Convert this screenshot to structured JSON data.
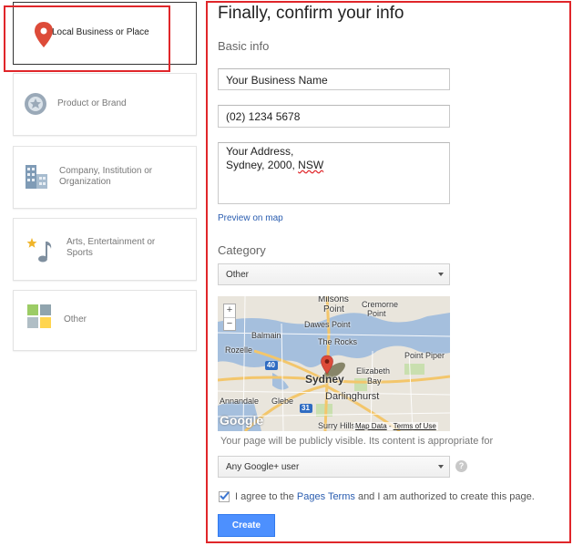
{
  "categories": [
    {
      "label_lines": [
        "Local Business or Place"
      ],
      "icon": "map-pin-icon"
    },
    {
      "label_lines": [
        "Product or Brand"
      ],
      "icon": "brand-tag-icon"
    },
    {
      "label_lines": [
        "Company, Institution or",
        "Organization"
      ],
      "icon": "building-icon"
    },
    {
      "label_lines": [
        "Arts, Entertainment or",
        "Sports"
      ],
      "icon": "music-star-icon"
    },
    {
      "label_lines": [
        "Other"
      ],
      "icon": "grid-tiles-icon"
    }
  ],
  "form": {
    "title": "Finally, confirm your info",
    "basic_info_label": "Basic info",
    "business_name": "Your Business Name",
    "phone": "(02) 1234 5678",
    "address_line1": "Your Address,",
    "address_line2_prefix": "Sydney, 2000, ",
    "address_line2_state": "NSW",
    "preview_link": "Preview on map",
    "category_label": "Category",
    "category_value": "Other",
    "visibility_text": "Your page will be publicly visible. Its content is appropriate for",
    "audience_value": "Any Google+ user",
    "help_glyph": "?",
    "agree_prefix": "I agree to the ",
    "agree_link": "Pages Terms",
    "agree_suffix": " and I am authorized to create this page.",
    "agree_checked": true,
    "create_label": "Create"
  },
  "map": {
    "zoom_in": "+",
    "zoom_out": "−",
    "logo": "Google",
    "data_link": "Map Data",
    "terms_sep": " - ",
    "terms_link": "Terms of Use",
    "labels": {
      "milsons_point": "Milsons",
      "milsons_point2": "Point",
      "cremorne": "Cremorne",
      "cremorne2": "Point",
      "dawes": "Dawes Point",
      "balmain": "Balmain",
      "rocks": "The Rocks",
      "rozelle": "Rozelle",
      "point_piper": "Point Piper",
      "sydney": "Sydney",
      "elizabeth": "Elizabeth",
      "elizabeth2": "Bay",
      "darlinghurst": "Darlinghurst",
      "annandale": "Annandale",
      "glebe": "Glebe",
      "surry": "Surry Hills",
      "route_40": "40",
      "route_31": "31"
    }
  },
  "colors": {
    "highlight": "#e0262a",
    "accent_blue": "#4d90fe",
    "pin_red": "#dd4b39"
  }
}
